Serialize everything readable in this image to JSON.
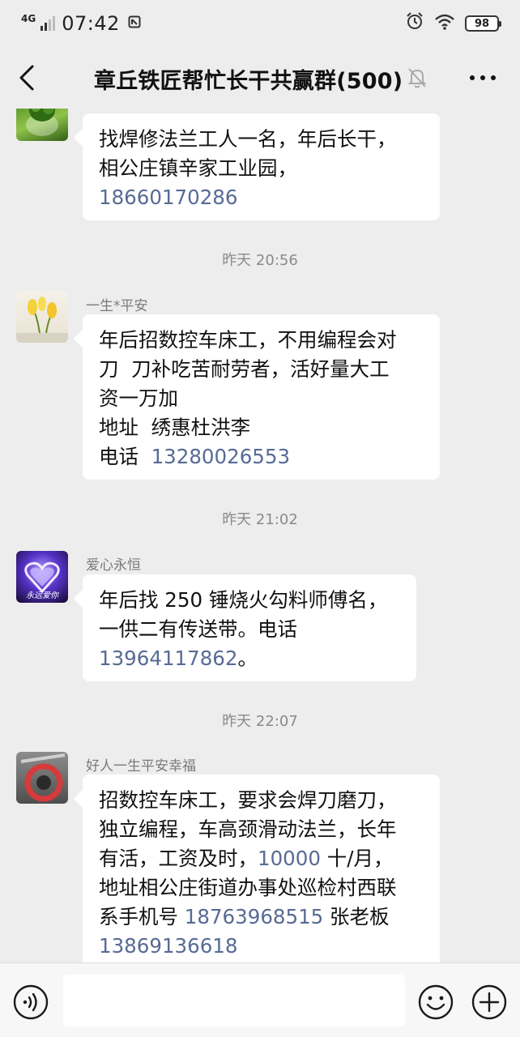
{
  "status_bar": {
    "network": "4G",
    "time": "07:42",
    "battery": "98"
  },
  "header": {
    "title": "章丘铁匠帮忙长干共赢群(500)"
  },
  "messages": [
    {
      "sender": "",
      "lines": [
        [
          {
            "t": "找焊修法兰工人一名，年后长干，"
          }
        ],
        [
          {
            "t": "相公庄镇辛家工业园，"
          }
        ],
        [
          {
            "t": "18660170286",
            "link": true
          }
        ]
      ]
    },
    {
      "timestamp": "昨天 20:56",
      "sender": "一生*平安",
      "lines": [
        [
          {
            "t": "年后招数控车床工，不用编程会对"
          }
        ],
        [
          {
            "t": "刀  刀补吃苦耐劳者，活好量大工"
          }
        ],
        [
          {
            "t": "资一万加"
          }
        ],
        [
          {
            "t": "地址  绣惠杜洪李"
          }
        ],
        [
          {
            "t": "电话  "
          },
          {
            "t": "13280026553",
            "link": true
          }
        ]
      ]
    },
    {
      "timestamp": "昨天 21:02",
      "sender": "爱心永恒",
      "avatar_text": "永远爱你",
      "lines": [
        [
          {
            "t": "年后找 250 锤烧火勾料师傅名，"
          }
        ],
        [
          {
            "t": "一供二有传送带。电话"
          }
        ],
        [
          {
            "t": "13964117862",
            "link": true
          },
          {
            "t": "。"
          }
        ]
      ]
    },
    {
      "timestamp": "昨天 22:07",
      "sender": "好人一生平安幸福",
      "lines": [
        [
          {
            "t": "招数控车床工，要求会焊刀磨刀，"
          }
        ],
        [
          {
            "t": "独立编程，车高颈滑动法兰，长年"
          }
        ],
        [
          {
            "t": "有活，工资及时，"
          },
          {
            "t": "10000",
            "link": true
          },
          {
            "t": " 十/月，"
          }
        ],
        [
          {
            "t": "地址相公庄街道办事处巡检村西联"
          }
        ],
        [
          {
            "t": "系手机号 "
          },
          {
            "t": "18763968515",
            "link": true
          },
          {
            "t": " 张老板"
          }
        ],
        [
          {
            "t": "13869136618",
            "link": true
          }
        ]
      ]
    }
  ],
  "icons": {
    "back": "chevron-left-icon",
    "mute": "bell-off-icon",
    "more": "more-horizontal-icon",
    "voice": "voice-icon",
    "emoji": "emoji-icon",
    "plus": "plus-icon"
  },
  "colors": {
    "background": "#ededed",
    "bubble": "#ffffff",
    "link": "#576b95",
    "timestamp": "#8a8a8a"
  }
}
